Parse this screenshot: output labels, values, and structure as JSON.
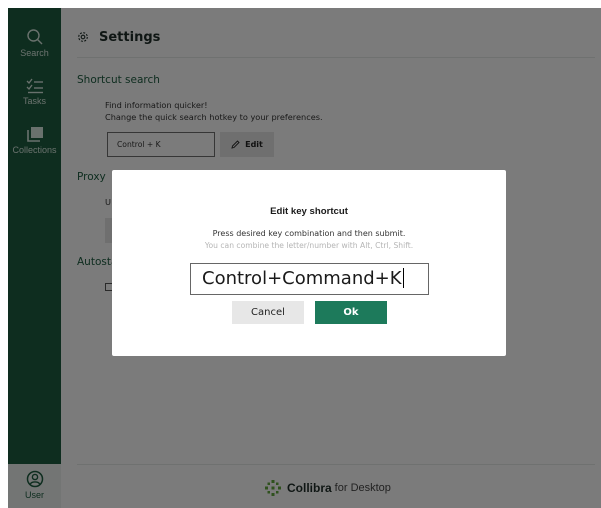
{
  "sidebar": {
    "items": [
      {
        "label": "Search",
        "icon": "search-icon"
      },
      {
        "label": "Tasks",
        "icon": "tasks-icon"
      },
      {
        "label": "Collections",
        "icon": "collections-icon"
      }
    ],
    "user": {
      "label": "User",
      "icon": "user-icon"
    }
  },
  "header": {
    "title": "Settings",
    "icon": "gear-icon"
  },
  "shortcut_search": {
    "title": "Shortcut search",
    "line1": "Find information quicker!",
    "line2": "Change the quick search hotkey to your preferences.",
    "current_hotkey": "Control + K",
    "edit_label": "Edit"
  },
  "proxy": {
    "title": "Proxy",
    "partial_text": "U"
  },
  "autostart": {
    "title": "Autosta"
  },
  "footer": {
    "brand": "Collibra",
    "suffix": "for Desktop"
  },
  "modal": {
    "title": "Edit key shortcut",
    "desc1": "Press desired key combination and then submit.",
    "desc2": "You can combine the letter/number with Alt, Ctrl, Shift.",
    "input_value": "Control+Command+K",
    "cancel_label": "Cancel",
    "ok_label": "Ok"
  },
  "colors": {
    "sidebar": "#1d5a3f",
    "accent": "#1d7a5b",
    "section_title": "#1d5a3f"
  }
}
